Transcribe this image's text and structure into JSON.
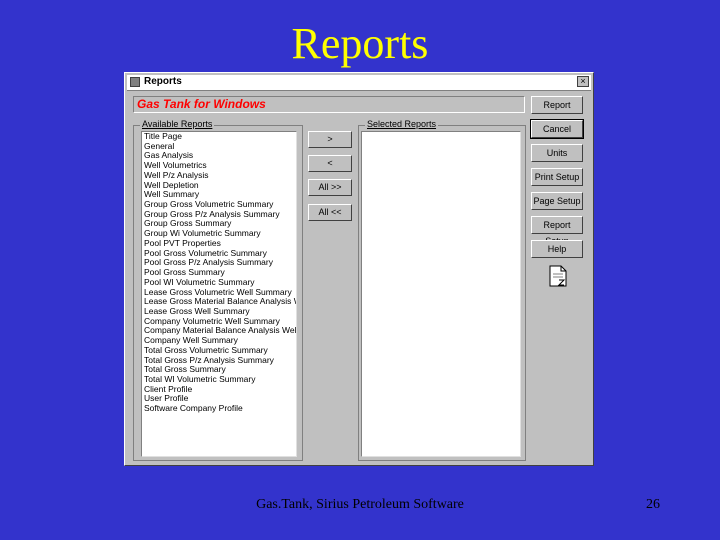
{
  "slide": {
    "title": "Reports",
    "footer": "Gas.Tank, Sirius Petroleum Software",
    "page_number": "26"
  },
  "window": {
    "title": "Reports",
    "close_label": "×",
    "app_name": "Gas Tank for Windows",
    "available_label": "Available Reports",
    "selected_label": "Selected Reports",
    "available_reports": [
      "Title Page",
      "General",
      "Gas Analysis",
      "Well Volumetrics",
      "Well P/z Analysis",
      "Well Depletion",
      "Well Summary",
      "Group Gross Volumetric Summary",
      "Group Gross P/z Analysis Summary",
      "Group Gross Summary",
      "Group Wi Volumetric Summary",
      "Pool PVT Properties",
      "Pool Gross Volumetric Summary",
      "Pool Gross P/z Analysis Summary",
      "Pool Gross Summary",
      "Pool WI Volumetric Summary",
      "Lease Gross Volumetric Well Summary",
      "Lease Gross Material Balance Analysis Wel",
      "Lease Gross Well Summary",
      "Company Volumetric Well Summary",
      "Company Material Balance Analysis Well Su",
      "Company Well Summary",
      "Total Gross Volumetric Summary",
      "Total Gross P/z Analysis Summary",
      "Total Gross Summary",
      "Total WI Volumetric Summary",
      "Client Profile",
      "User Profile",
      "Software Company Profile"
    ],
    "selected_reports": [],
    "transfer_buttons": {
      "add": ">",
      "remove": "<",
      "add_all": "All >>",
      "remove_all": "All <<"
    },
    "action_buttons": {
      "report": "Report",
      "cancel": "Cancel",
      "units": "Units",
      "print_setup": "Print Setup",
      "page_setup": "Page Setup",
      "report_setup": "Report Setup",
      "help": "Help"
    }
  },
  "icons": {
    "document": "document-icon"
  }
}
